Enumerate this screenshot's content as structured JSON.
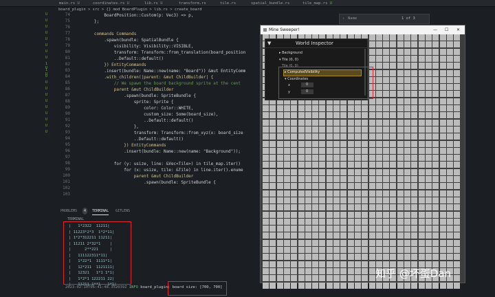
{
  "editor": {
    "tabs": [
      "main.rs",
      "coordinates.rs",
      "lib.rs",
      "transform.rs",
      "tile.rs",
      "spatial_bundle.rs",
      "tile_map.rs"
    ],
    "tab_markers": [
      "U",
      "U",
      "U",
      "",
      "",
      "",
      "U"
    ],
    "breadcrumb": "board_plugin > src > {} mod BoardPlugin > lib.rs > create_board",
    "find": {
      "placeholder": "Name",
      "count": "1 of 3"
    },
    "line_numbers": [
      "74",
      "75",
      "76",
      "77",
      "78",
      "79",
      "80",
      "81",
      "82",
      "83",
      "84",
      "85",
      "86",
      "87",
      "88",
      "89",
      "90",
      "91",
      "92",
      "93",
      "94",
      "95",
      "96",
      "97",
      "98",
      "99",
      "100",
      "101",
      "102",
      "103"
    ],
    "code_lines": [
      "            BoardPosition::Custom(p: Vec3) => p,",
      "        };",
      "",
      "        commands Commands",
      "            .spawn(bundle: SpatialBundle {",
      "                visibility: Visibility::VISIBLE,",
      "                transform: Transform::from_translation(board_position",
      "                ..Default::default()",
      "            }) EntityCommands",
      "            .insert(bundle: Name::new(name: \"Board\")) &mut EntityComm",
      "            .with_children(|parent: &mut ChildBuilder| {",
      "                // We spawn the board background sprite at the cent",
      "                parent &mut ChildBuilder",
      "                    .spawn(bundle: SpriteBundle {",
      "                        sprite: Sprite {",
      "                            color: Color::WHITE,",
      "                            custom_size: Some(board_size),",
      "                            ..Default::default()",
      "                        },",
      "                        transform: Transform::from_xyz(x: board_size",
      "                        ..Default::default()",
      "                    }) EntityCommands",
      "                    .insert(bundle: Name::new(name: \"Background\"));",
      "",
      "                for (y: usize, line: &Vec<Tile>) in tile_map.iter()",
      "                    for (x: usize, tile: &Tile) in line.iter().enume",
      "                        parent &mut ChildBuilder",
      "                            .spawn(bundle: SpriteBundle {",
      "",
      ""
    ],
    "git_markers": [
      "U",
      "U",
      "U",
      "U",
      "U",
      "U",
      "U",
      "U",
      "1 U",
      "1 U",
      "U",
      "U",
      "U",
      "U",
      "U",
      "U",
      "U",
      "U",
      "U",
      "U"
    ]
  },
  "panel": {
    "tabs": [
      "PROBLEMS",
      "4",
      "TERMINAL",
      "GITLENS"
    ],
    "terminal_label": "TERMINAL",
    "board_rows": [
      "|   1*2322  11211|",
      "| 11223*2*3  1*2*11|",
      "| 1*2*312211 11211|",
      "| 11211 2*32*1    |",
      "|      2**221     |",
      "|   111122311*11|",
      "|   1*22*1  1111*1|",
      "|   12*211  1121111|",
      "|   12321   1*1 1*1|",
      "|   1*2*1 122211 22|",
      "|   11211 1**1   1*1|"
    ],
    "log_time": "2023-02-10T06:41:48.352039Z",
    "log_level": "INFO",
    "log_target": "board_plugin:",
    "log_message": "board size: [700, 700]"
  },
  "game_window": {
    "title": "Mine Sweeper!",
    "controls": [
      "—",
      "☐",
      "✕"
    ],
    "grid_cols": 28,
    "grid_rows": 36
  },
  "inspector": {
    "title": "World Inspector",
    "items": [
      "Background",
      "Tile (0, 0)",
      "Tile (0, 0)",
      "ComputedVisibility",
      "Coordinates"
    ],
    "x_label": "x",
    "x_value": "0",
    "y_label": "y",
    "y_value": "0"
  },
  "watermark": "知乎 @坏蛋Dan",
  "colors": {
    "highlight_red": "#e0262f",
    "grid_cell": "#bcbcbc",
    "game_bg": "#3d3d3d"
  }
}
